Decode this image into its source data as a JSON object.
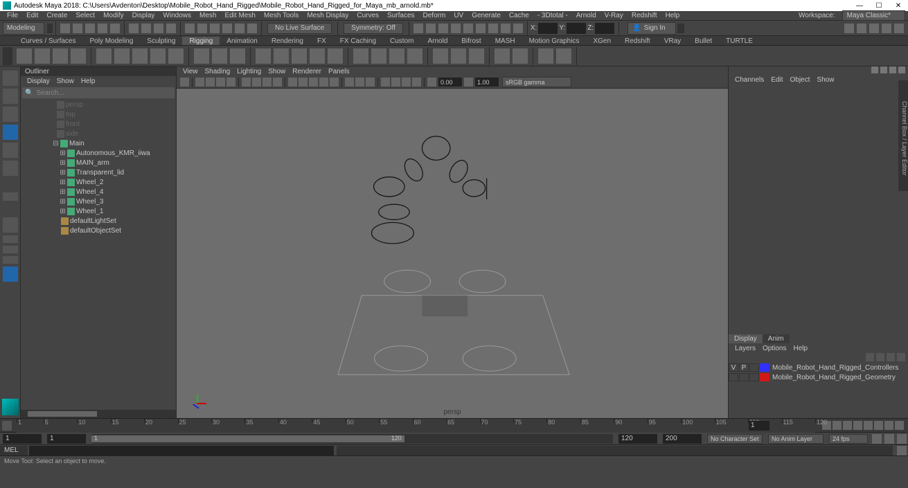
{
  "title": "Autodesk Maya 2018: C:\\Users\\Avdenton\\Desktop\\Mobile_Robot_Hand_Rigged\\Mobile_Robot_Hand_Rigged_for_Maya_mb_arnold.mb*",
  "main_menu": [
    "File",
    "Edit",
    "Create",
    "Select",
    "Modify",
    "Display",
    "Windows",
    "Mesh",
    "Edit Mesh",
    "Mesh Tools",
    "Mesh Display",
    "Curves",
    "Surfaces",
    "Deform",
    "UV",
    "Generate",
    "Cache",
    "- 3Dtotal -",
    "Arnold",
    "V-Ray",
    "Redshift",
    "Help"
  ],
  "workspace_lbl": "Workspace:",
  "workspace_val": "Maya Classic*",
  "mode": "Modeling",
  "no_live": "No Live Surface",
  "symmetry": "Symmetry: Off",
  "xyz": {
    "x": "X:",
    "y": "Y:",
    "z": "Z:"
  },
  "sign_in": "Sign In",
  "shelf_tabs": [
    "Curves / Surfaces",
    "Poly Modeling",
    "Sculpting",
    "Rigging",
    "Animation",
    "Rendering",
    "FX",
    "FX Caching",
    "Custom",
    "Arnold",
    "Bifrost",
    "MASH",
    "Motion Graphics",
    "XGen",
    "Redshift",
    "VRay",
    "Bullet",
    "TURTLE"
  ],
  "shelf_active": 3,
  "outliner": {
    "title": "Outliner",
    "menu": [
      "Display",
      "Show",
      "Help"
    ],
    "search": "Search...",
    "items": [
      {
        "pad": 50,
        "ico": "cam",
        "txt": "persp",
        "dim": true
      },
      {
        "pad": 50,
        "ico": "cam",
        "txt": "top",
        "dim": true
      },
      {
        "pad": 50,
        "ico": "cam",
        "txt": "front",
        "dim": true
      },
      {
        "pad": 50,
        "ico": "cam",
        "txt": "side",
        "dim": true
      },
      {
        "pad": 46,
        "exp": "⊟",
        "ico": "grp",
        "txt": "Main"
      },
      {
        "pad": 56,
        "exp": "⊞",
        "ico": "grp",
        "txt": "Autonomous_KMR_iiwa"
      },
      {
        "pad": 56,
        "exp": "⊞",
        "ico": "grp",
        "txt": "MAIN_arm"
      },
      {
        "pad": 56,
        "exp": "⊞",
        "ico": "grp",
        "txt": "Transparent_lid"
      },
      {
        "pad": 56,
        "exp": "⊞",
        "ico": "grp",
        "txt": "Wheel_2"
      },
      {
        "pad": 56,
        "exp": "⊞",
        "ico": "grp",
        "txt": "Wheel_4"
      },
      {
        "pad": 56,
        "exp": "⊞",
        "ico": "grp",
        "txt": "Wheel_3"
      },
      {
        "pad": 56,
        "exp": "⊞",
        "ico": "grp",
        "txt": "Wheel_1"
      },
      {
        "pad": 56,
        "ico": "set",
        "txt": "defaultLightSet"
      },
      {
        "pad": 56,
        "ico": "set",
        "txt": "defaultObjectSet"
      }
    ]
  },
  "viewport": {
    "menu": [
      "View",
      "Shading",
      "Lighting",
      "Show",
      "Renderer",
      "Panels"
    ],
    "exposure": "0.00",
    "gamma": "1.00",
    "colorspace": "sRGB gamma",
    "label": "persp"
  },
  "channel": {
    "menu": [
      "Channels",
      "Edit",
      "Object",
      "Show"
    ]
  },
  "layers": {
    "tabs": [
      "Display",
      "Anim"
    ],
    "menu": [
      "Layers",
      "Options",
      "Help"
    ],
    "rows": [
      {
        "v": "V",
        "p": "P",
        "color": "#3030ff",
        "name": "Mobile_Robot_Hand_Rigged_Controllers"
      },
      {
        "v": "",
        "p": "",
        "color": "#d01818",
        "name": "Mobile_Robot_Hand_Rigged_Geometry"
      }
    ]
  },
  "right_tab": "Channel Box / Layer Editor",
  "timeline": {
    "ticks": [
      1,
      5,
      10,
      15,
      20,
      25,
      30,
      35,
      40,
      45,
      50,
      55,
      60,
      65,
      70,
      75,
      80,
      85,
      90,
      95,
      100,
      105,
      110,
      115,
      120
    ],
    "cur": "1"
  },
  "range": {
    "start": "1",
    "pstart": "1",
    "slider_lbl": "1",
    "slider_end": "120",
    "pend": "120",
    "end": "200",
    "charset": "No Character Set",
    "animlayer": "No Anim Layer",
    "fps": "24 fps"
  },
  "cmd": {
    "lang": "MEL"
  },
  "help": "Move Tool: Select an object to move."
}
